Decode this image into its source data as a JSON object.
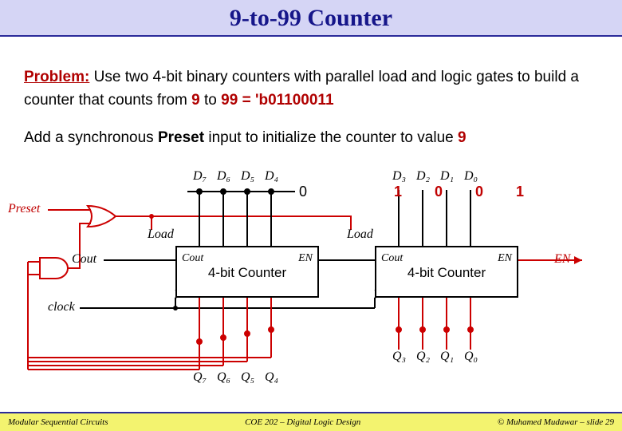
{
  "title": "9-to-99 Counter",
  "problem_label": "Problem:",
  "problem_text_1": " Use two 4-bit binary counters with parallel load and logic gates to build a counter that counts from ",
  "nine": "9",
  "to_word": " to ",
  "ninetynine": "99 = 'b01100011",
  "preset_sentence_1": "Add a synchronous ",
  "preset_word": "Preset",
  "preset_sentence_2": " input to initialize the counter to value ",
  "preset_val": "9",
  "diagram": {
    "preset": "Preset",
    "load_left": "Load",
    "load_right": "Load",
    "cout_ext": "Cout",
    "en_ext": "EN",
    "clock": "clock",
    "d7": "D₇",
    "d6": "D₆",
    "d5": "D₅",
    "d4": "D₄",
    "d3": "D₃",
    "d2": "D₂",
    "d1": "D₁",
    "d0": "D₀",
    "q7": "Q₇",
    "q6": "Q₆",
    "q5": "Q₅",
    "q4": "Q₄",
    "q3": "Q₃",
    "q2": "Q₂",
    "q1": "Q₁",
    "q0": "Q₀",
    "zero": "0",
    "bits_high": "0",
    "bits_low": "1 0 0 1",
    "counter_label": "4-bit Counter",
    "cout_pin": "Cout",
    "en_pin": "EN"
  },
  "footer": {
    "left": "Modular Sequential Circuits",
    "center": "COE 202 – Digital Logic Design",
    "right": "© Muhamed Mudawar – slide 29"
  }
}
